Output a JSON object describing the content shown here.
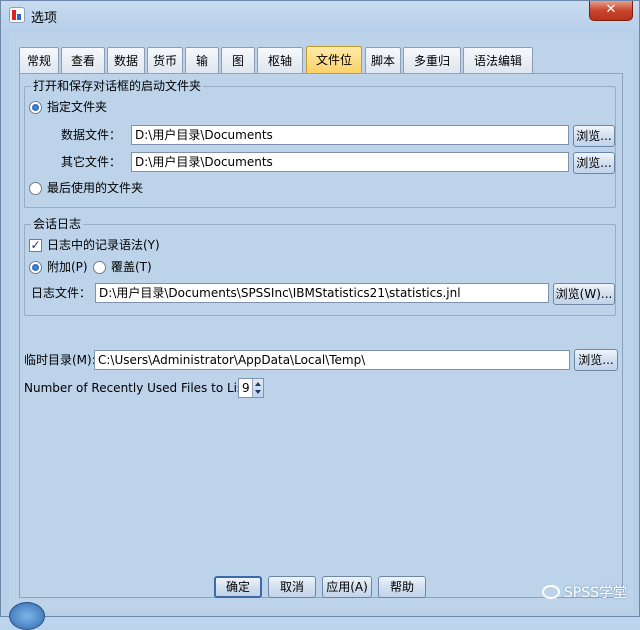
{
  "window": {
    "title": "选项",
    "close_label": "✕"
  },
  "tabs": [
    {
      "label": "常规"
    },
    {
      "label": "查看器"
    },
    {
      "label": "数据"
    },
    {
      "label": "货币"
    },
    {
      "label": "输出"
    },
    {
      "label": "图表"
    },
    {
      "label": "枢轴表"
    },
    {
      "label": "文件位置",
      "active": true
    },
    {
      "label": "脚本"
    },
    {
      "label": "多重归因"
    },
    {
      "label": "语法编辑器"
    }
  ],
  "startup_group": {
    "legend": "打开和保存对话框的启动文件夹",
    "specified_label": "指定文件夹",
    "data_file_label": "数据文件：",
    "data_file_value": "D:\\用户目录\\Documents",
    "other_file_label": "其它文件：",
    "other_file_value": "D:\\用户目录\\Documents",
    "browse_label": "浏览...",
    "last_used_label": "最后使用的文件夹"
  },
  "journal_group": {
    "legend": "会话日志",
    "record_syntax_label": "日志中的记录语法(Y)",
    "record_syntax_checked": true,
    "append_label": "附加(P)",
    "overwrite_label": "覆盖(T)",
    "journal_file_label": "日志文件：",
    "journal_file_value": "D:\\用户目录\\Documents\\SPSSInc\\IBMStatistics21\\statistics.jnl",
    "browse_label": "浏览(W)..."
  },
  "temp": {
    "label": "临时目录(M):",
    "value": "C:\\Users\\Administrator\\AppData\\Local\\Temp\\",
    "browse_label": "浏览..."
  },
  "recent": {
    "label": "Number of Recently Used Files to List:",
    "value": "9"
  },
  "buttons": {
    "ok": "确定",
    "cancel": "取消",
    "apply": "应用(A)",
    "help": "帮助"
  },
  "watermark": "SPSS学堂"
}
